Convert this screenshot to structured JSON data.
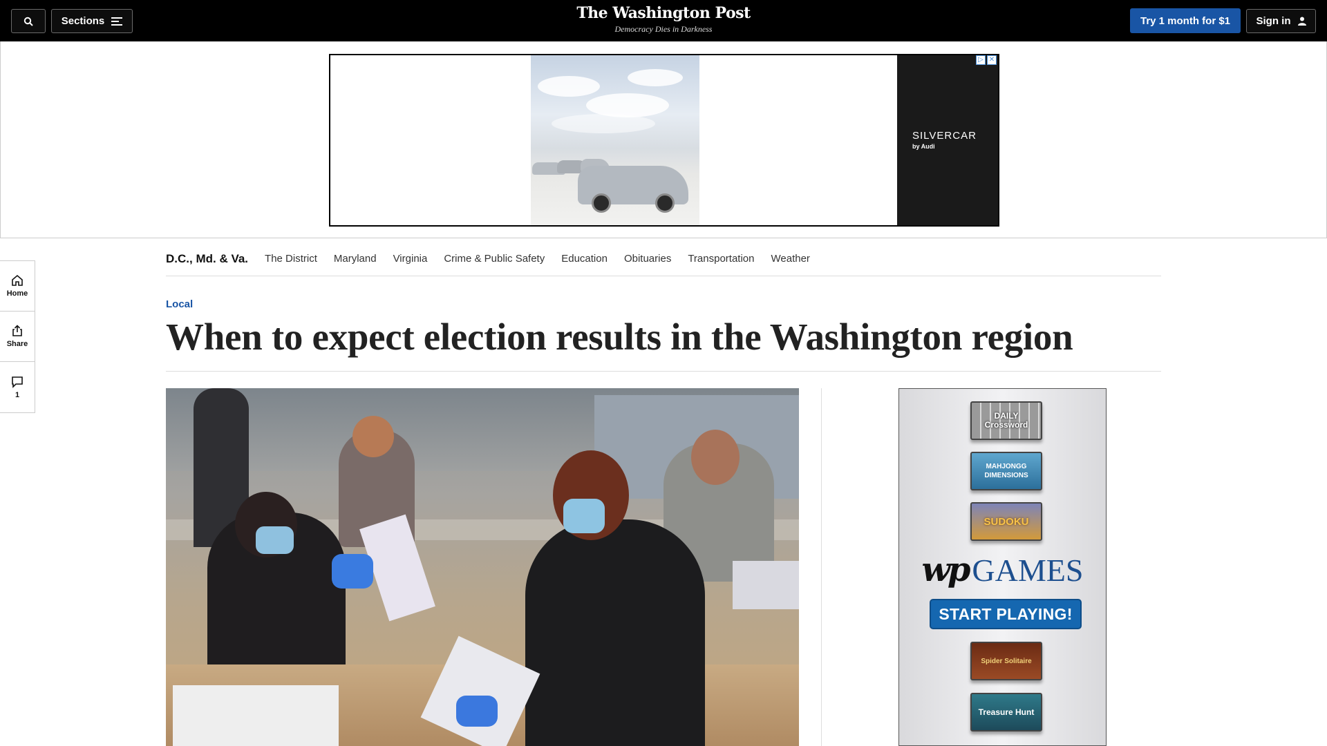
{
  "header": {
    "sections_label": "Sections",
    "logo_name": "The Washington Post",
    "logo_tagline": "Democracy Dies in Darkness",
    "subscribe_label": "Try 1 month for $1",
    "signin_label": "Sign in"
  },
  "ad": {
    "brand": "SILVERCAR",
    "brand_sub": "by Audi"
  },
  "rail": {
    "home_label": "Home",
    "share_label": "Share",
    "comments_count": "1"
  },
  "subnav": {
    "title": "D.C., Md. & Va.",
    "items": [
      "The District",
      "Maryland",
      "Virginia",
      "Crime & Public Safety",
      "Education",
      "Obituaries",
      "Transportation",
      "Weather"
    ]
  },
  "article": {
    "kicker": "Local",
    "headline": "When to expect election results in the Washington region"
  },
  "games_ad": {
    "tiles": [
      "DAILY Crossword",
      "MAHJONGG DIMENSIONS",
      "SUDOKU",
      "Spider Solitaire",
      "Treasure Hunt"
    ],
    "brand_wp": "wp",
    "brand_games": "GAMES",
    "cta": "START PLAYING!"
  },
  "colors": {
    "brand_blue": "#1955a5",
    "header_bg": "#000000"
  }
}
